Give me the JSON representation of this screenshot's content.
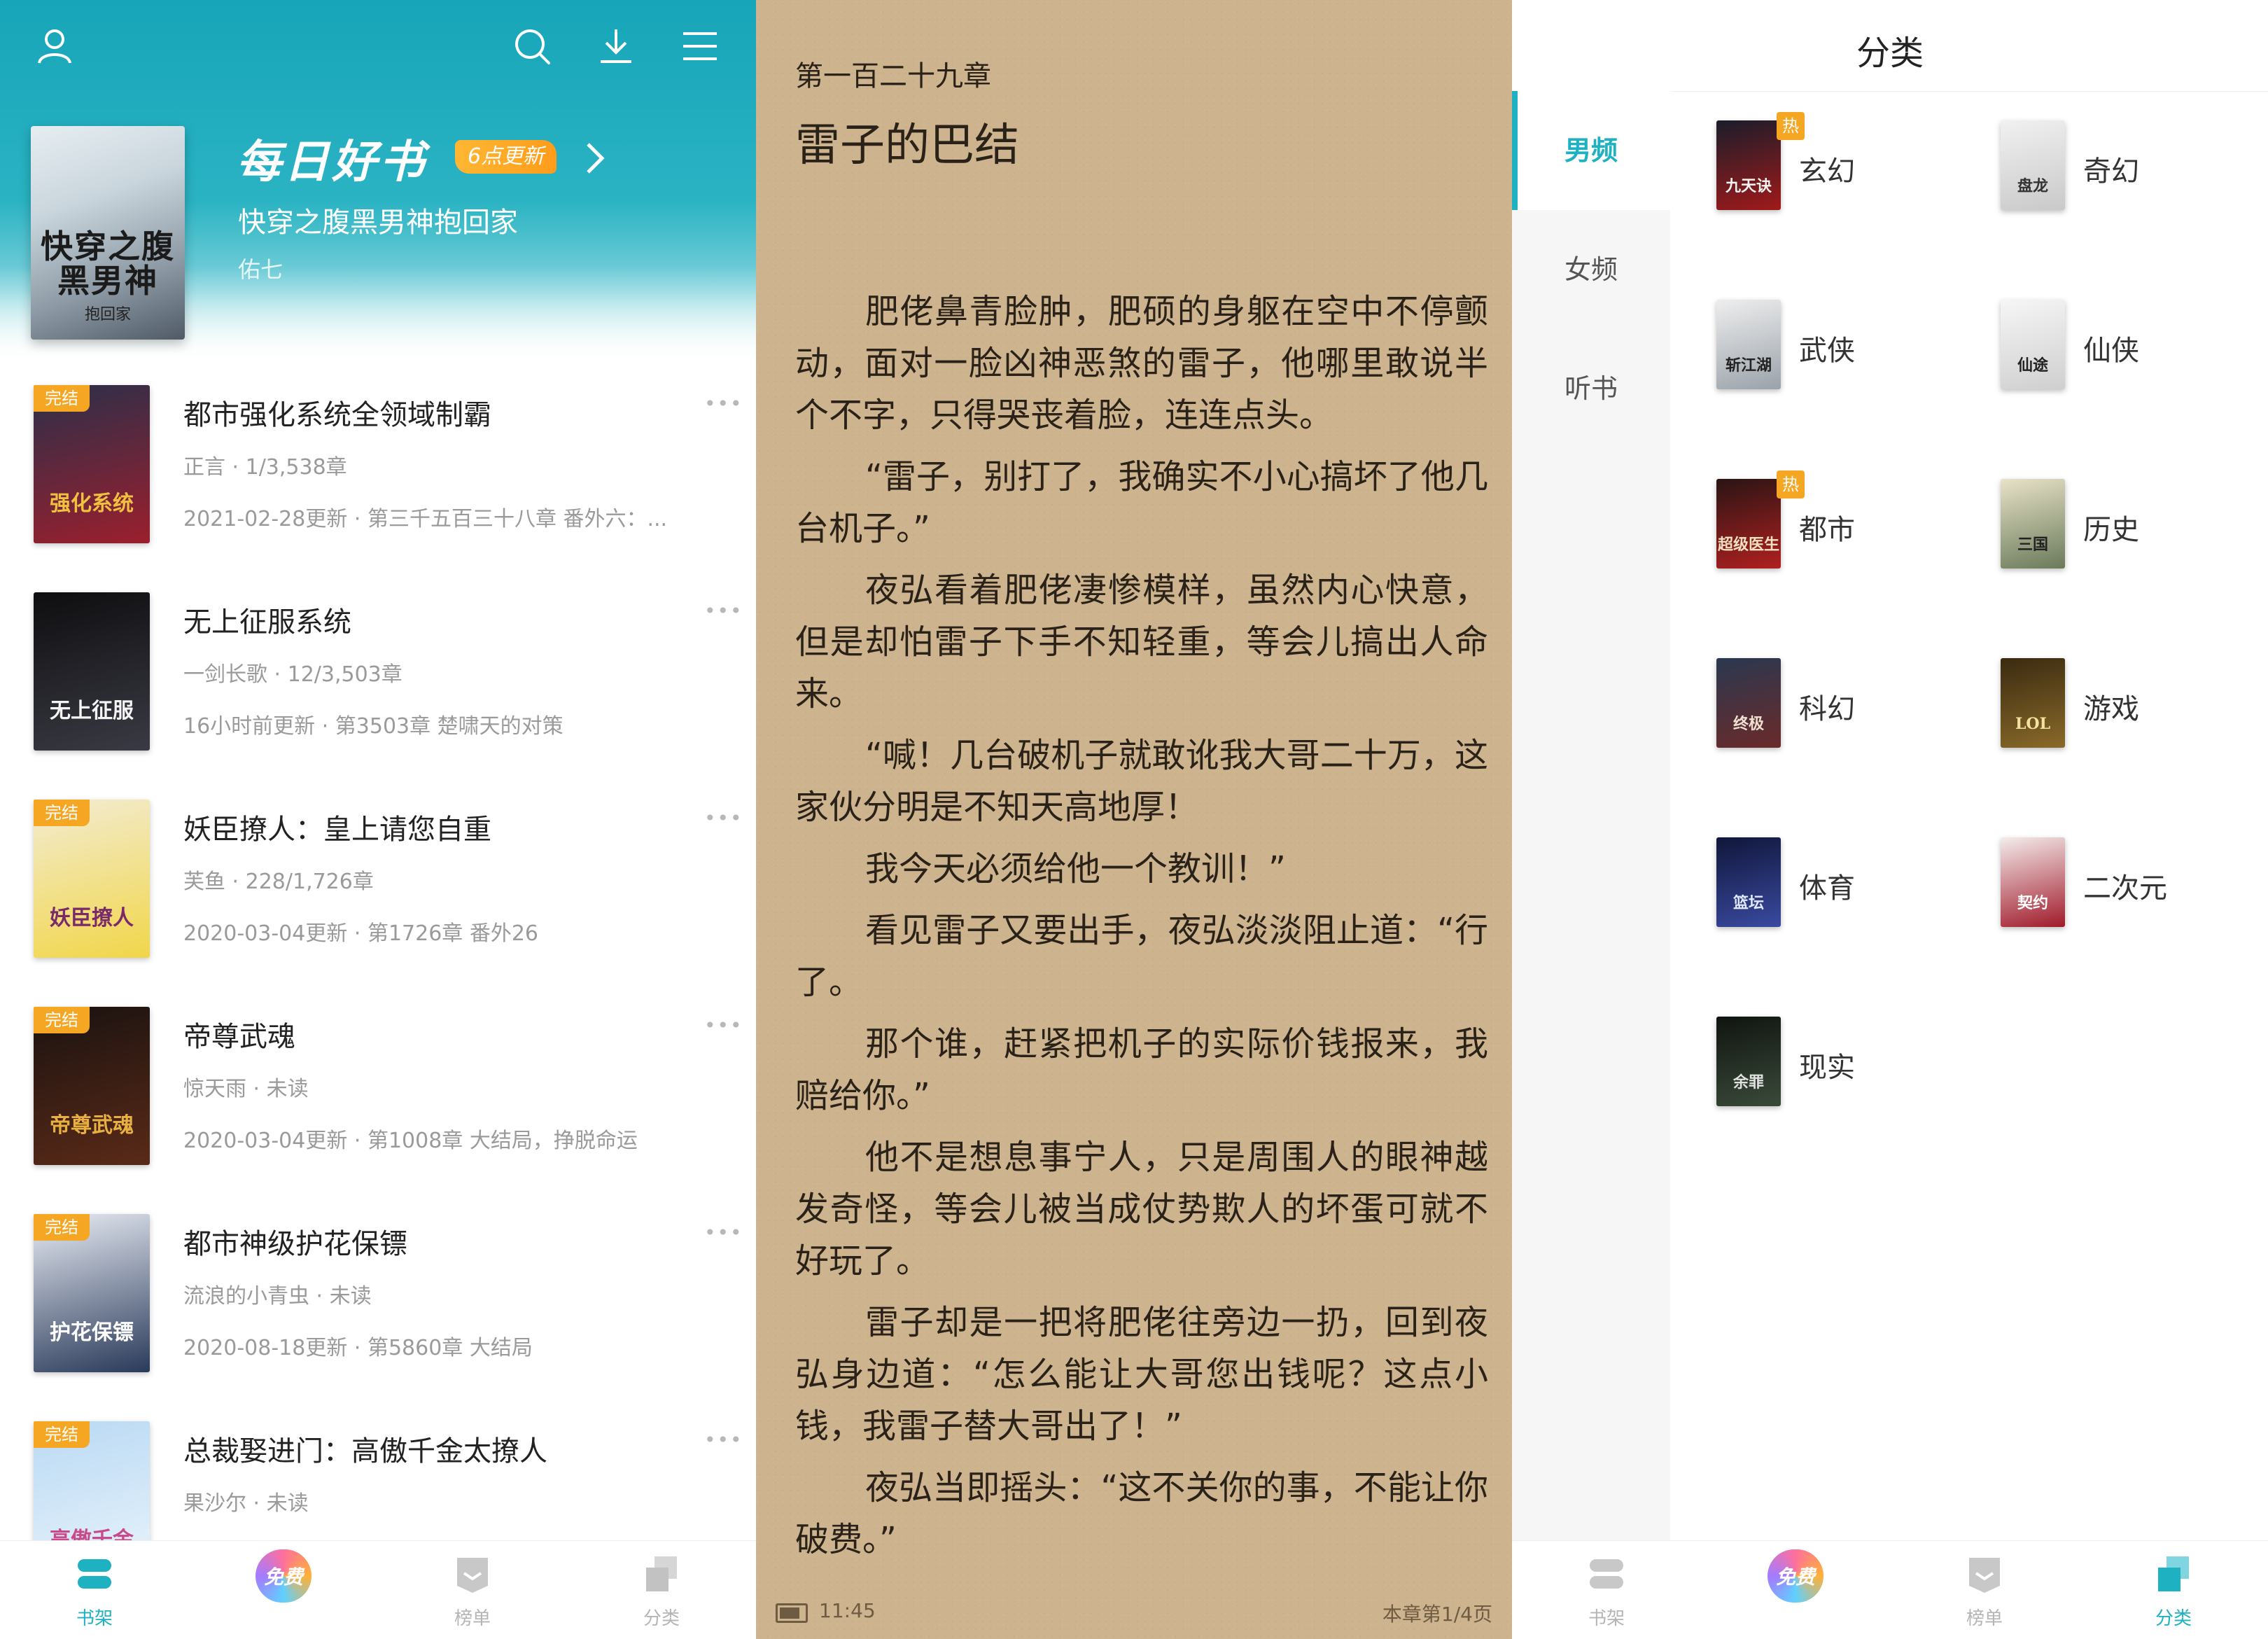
{
  "shelf": {
    "daily": {
      "title": "每日好书",
      "badge": "6点更新",
      "book_title": "快穿之腹黑男神抱回家",
      "author": "佑七",
      "cover_text": "快穿之腹黑男神",
      "cover_sub": "抱回家"
    },
    "books": [
      {
        "cover_text": "强化系统",
        "tag": "完结",
        "title": "都市强化系统全领域制霸",
        "meta": "正言  ·  1/3,538章",
        "update": "2021-02-28更新  ·  第三千五百三十八章 番外六：..."
      },
      {
        "cover_text": "无上征服",
        "tag": "",
        "title": "无上征服系统",
        "meta": "一剑长歌  ·  12/3,503章",
        "update": "16小时前更新  ·  第3503章 楚啸天的对策"
      },
      {
        "cover_text": "妖臣撩人",
        "tag": "完结",
        "title": "妖臣撩人：皇上请您自重",
        "meta": "芙鱼  ·  228/1,726章",
        "update": "2020-03-04更新  ·  第1726章   番外26"
      },
      {
        "cover_text": "帝尊武魂",
        "tag": "完结",
        "title": "帝尊武魂",
        "meta": "惊天雨  ·  未读",
        "update": "2020-03-04更新  ·  第1008章 大结局，挣脱命运"
      },
      {
        "cover_text": "护花保镖",
        "tag": "完结",
        "title": "都市神级护花保镖",
        "meta": "流浪的小青虫  ·  未读",
        "update": "2020-08-18更新  ·  第5860章          大结局"
      },
      {
        "cover_text": "高傲千金",
        "tag": "完结",
        "title": "总裁娶进门：高傲千金太撩人",
        "meta": "果沙尔  ·  未读",
        "update": ""
      }
    ],
    "more_glyph": "•••",
    "tabs": [
      "书架",
      "免费",
      "榜单",
      "分类"
    ]
  },
  "reader": {
    "chapter_no": "第一百二十九章",
    "chapter_title": "雷子的巴结",
    "paragraphs": [
      "肥佬鼻青脸肿，肥硕的身躯在空中不停颤动，面对一脸凶神恶煞的雷子，他哪里敢说半个不字，只得哭丧着脸，连连点头。",
      "“雷子，别打了，我确实不小心搞坏了他几台机子。”",
      "夜弘看着肥佬凄惨模样，虽然内心快意，但是却怕雷子下手不知轻重，等会儿搞出人命来。",
      "“喊！几台破机子就敢讹我大哥二十万，这家伙分明是不知天高地厚！",
      "我今天必须给他一个教训！”",
      "看见雷子又要出手，夜弘淡淡阻止道：“行了。",
      "那个谁，赶紧把机子的实际价钱报来，我赔给你。”",
      "他不是想息事宁人，只是周围人的眼神越发奇怪，等会儿被当成仗势欺人的坏蛋可就不好玩了。",
      "雷子却是一把将肥佬往旁边一扔，回到夜弘身边道：“怎么能让大哥您出钱呢？这点小钱，我雷子替大哥出了！”",
      "夜弘当即摇头：“这不关你的事，不能让你破费。”"
    ],
    "time": "11:45",
    "page": "本章第1/4页"
  },
  "categories": {
    "title": "分类",
    "side": [
      "男频",
      "女频",
      "听书"
    ],
    "items": [
      {
        "label": "玄幻",
        "hot": "热",
        "cover_text": "九天诀"
      },
      {
        "label": "奇幻",
        "hot": "",
        "cover_text": "盘龙"
      },
      {
        "label": "武侠",
        "hot": "",
        "cover_text": "斩江湖"
      },
      {
        "label": "仙侠",
        "hot": "",
        "cover_text": "仙途"
      },
      {
        "label": "都市",
        "hot": "热",
        "cover_text": "超级医生"
      },
      {
        "label": "历史",
        "hot": "",
        "cover_text": "三国"
      },
      {
        "label": "科幻",
        "hot": "",
        "cover_text": "终极"
      },
      {
        "label": "游戏",
        "hot": "",
        "cover_text": "LOL"
      },
      {
        "label": "体育",
        "hot": "",
        "cover_text": "篮坛"
      },
      {
        "label": "二次元",
        "hot": "",
        "cover_text": "契约"
      },
      {
        "label": "现实",
        "hot": "",
        "cover_text": "余罪"
      }
    ],
    "tabs": [
      "书架",
      "免费",
      "榜单",
      "分类"
    ]
  },
  "colors": {
    "accent": "#1eb1c1",
    "tag": "#f5a623",
    "paper": "#cdb38e"
  }
}
